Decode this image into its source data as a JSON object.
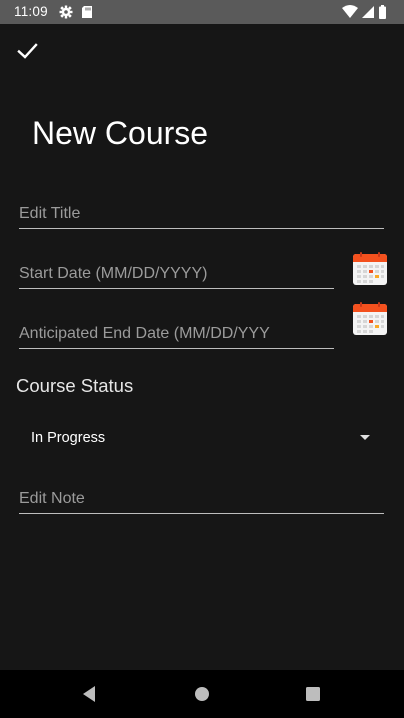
{
  "status_bar": {
    "time": "11:09",
    "left_icons": [
      "gear-icon",
      "sd-card-icon"
    ],
    "right_icons": [
      "wifi-icon",
      "cell-signal-icon",
      "battery-icon"
    ]
  },
  "toolbar": {
    "confirm_icon": "check-icon"
  },
  "page": {
    "title": "New Course"
  },
  "form": {
    "title_field": {
      "value": "",
      "placeholder": "Edit Title"
    },
    "start_date_field": {
      "value": "",
      "placeholder": "Start Date (MM/DD/YYYY)",
      "picker_icon": "calendar-icon"
    },
    "end_date_field": {
      "value": "",
      "placeholder": "Anticipated End Date (MM/DD/YYY",
      "picker_icon": "calendar-icon"
    },
    "status_label": "Course Status",
    "status_selected": "In Progress",
    "note_field": {
      "value": "",
      "placeholder": "Edit Note"
    }
  },
  "nav_bar": {
    "buttons": [
      "back-icon",
      "home-icon",
      "recents-icon"
    ]
  },
  "colors": {
    "background": "#161616",
    "status_bar": "#5a5a5a",
    "text": "#ffffff",
    "hint": "#9b9b9b",
    "underline": "#bdbdbd",
    "calendar_accent": "#f4511e"
  }
}
